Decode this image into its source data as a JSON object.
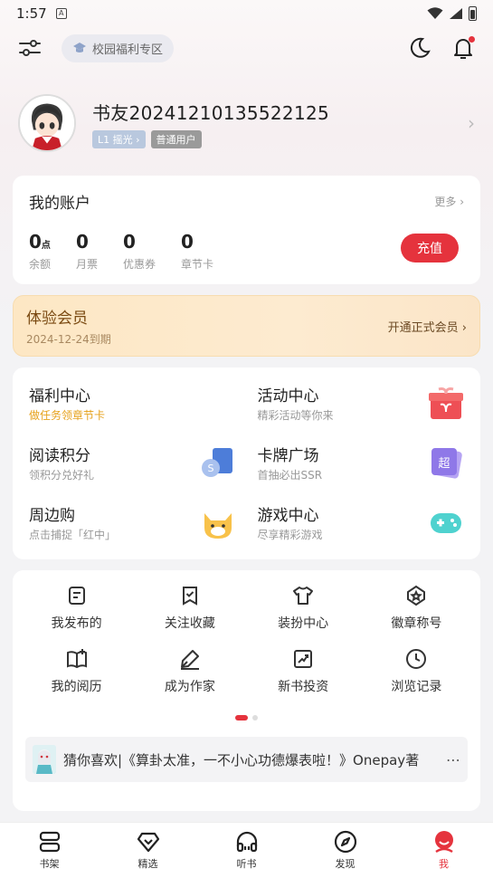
{
  "status_bar": {
    "time": "1:57",
    "sim_label": "A"
  },
  "toolbar": {
    "campus_label": "校园福利专区"
  },
  "profile": {
    "username": "书友20241210135522125",
    "level_badge": "L1 摇光 ›",
    "user_type": "普通用户"
  },
  "account": {
    "title": "我的账户",
    "more": "更多 ›",
    "stats": [
      {
        "value": "0",
        "unit": "点",
        "label": "余额"
      },
      {
        "value": "0",
        "unit": "",
        "label": "月票"
      },
      {
        "value": "0",
        "unit": "",
        "label": "优惠券"
      },
      {
        "value": "0",
        "unit": "",
        "label": "章节卡"
      }
    ],
    "recharge": "充值"
  },
  "vip": {
    "title": "体验会员",
    "expiry": "2024-12-24到期",
    "cta": "开通正式会员 ›"
  },
  "features": [
    {
      "title": "福利中心",
      "subtitle": "做任务领章节卡",
      "icon": "gift-box-icon"
    },
    {
      "title": "活动中心",
      "subtitle": "精彩活动等你来",
      "icon": "gift-icon"
    },
    {
      "title": "阅读积分",
      "subtitle": "领积分兑好礼",
      "icon": "points-icon"
    },
    {
      "title": "卡牌广场",
      "subtitle": "首抽必出SSR",
      "icon": "card-icon"
    },
    {
      "title": "周边购",
      "subtitle": "点击捕捉「红中」",
      "icon": "cat-icon"
    },
    {
      "title": "游戏中心",
      "subtitle": "尽享精彩游戏",
      "icon": "gamepad-icon"
    }
  ],
  "tools": [
    {
      "label": "我发布的",
      "icon": "post-icon"
    },
    {
      "label": "关注收藏",
      "icon": "bookmark-check-icon"
    },
    {
      "label": "装扮中心",
      "icon": "shirt-icon"
    },
    {
      "label": "徽章称号",
      "icon": "badge-icon"
    },
    {
      "label": "我的阅历",
      "icon": "book-plus-icon"
    },
    {
      "label": "成为作家",
      "icon": "pen-icon"
    },
    {
      "label": "新书投资",
      "icon": "chart-icon"
    },
    {
      "label": "浏览记录",
      "icon": "clock-icon"
    }
  ],
  "recommend": {
    "text": "猜你喜欢|《算卦太准，一不小心功德爆表啦！》Onepay著",
    "more": "⋯"
  },
  "tabs": [
    {
      "label": "书架",
      "icon": "bookshelf-icon"
    },
    {
      "label": "精选",
      "icon": "diamond-icon"
    },
    {
      "label": "听书",
      "icon": "headphones-icon"
    },
    {
      "label": "发现",
      "icon": "compass-icon"
    },
    {
      "label": "我",
      "icon": "profile-icon"
    }
  ],
  "colors": {
    "accent": "#e5333d",
    "vip_text": "#7a4a12",
    "welfare_orange": "#e6a11b"
  }
}
